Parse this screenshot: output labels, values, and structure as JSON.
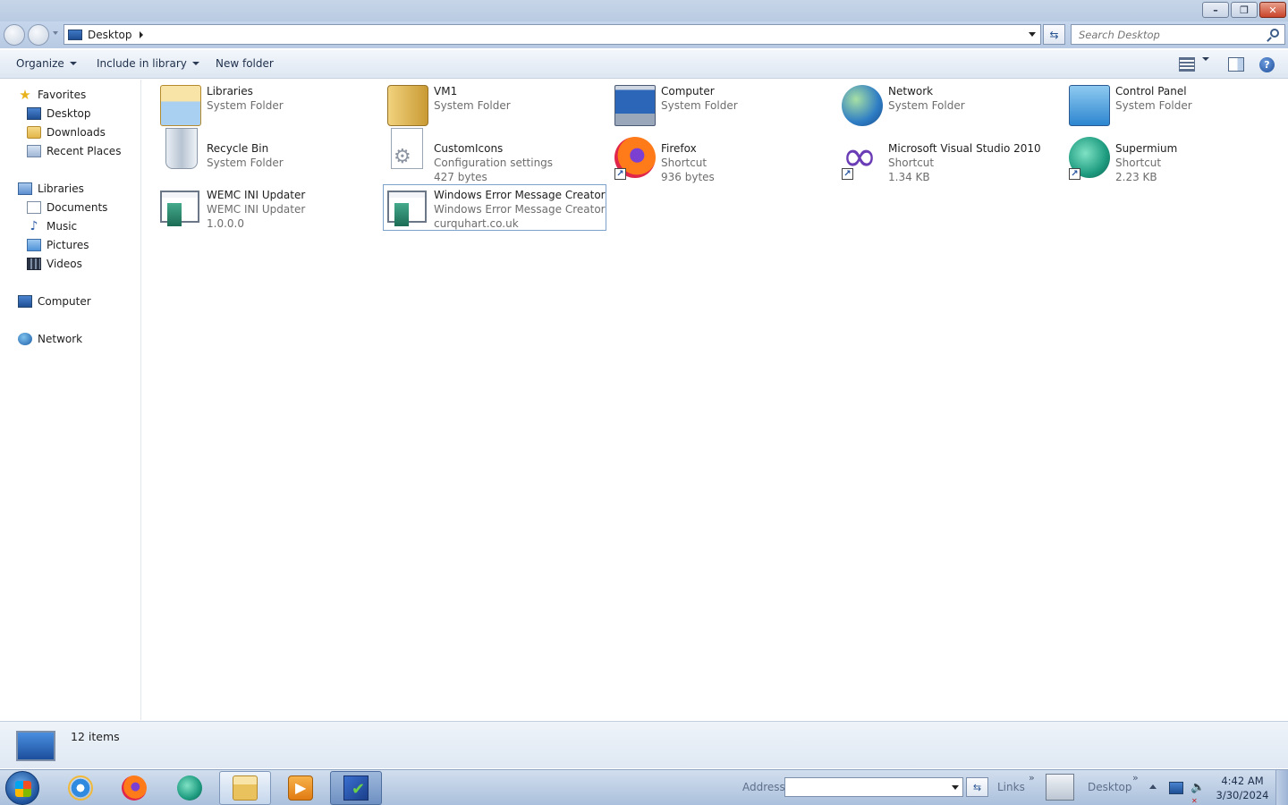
{
  "window": {
    "address_crumb": "Desktop",
    "search_placeholder": "Search Desktop"
  },
  "toolbar": {
    "organize": "Organize",
    "include_in_library": "Include in library",
    "new_folder": "New folder"
  },
  "sidebar": {
    "favorites": {
      "header": "Favorites",
      "items": [
        "Desktop",
        "Downloads",
        "Recent Places"
      ]
    },
    "libraries": {
      "header": "Libraries",
      "items": [
        "Documents",
        "Music",
        "Pictures",
        "Videos"
      ]
    },
    "computer": "Computer",
    "network": "Network"
  },
  "items": [
    {
      "name": "Libraries",
      "line2": "System Folder",
      "line3": "",
      "icon": "libraries-folder-icon"
    },
    {
      "name": "VM1",
      "line2": "System Folder",
      "line3": "",
      "icon": "user-folder-icon"
    },
    {
      "name": "Computer",
      "line2": "System Folder",
      "line3": "",
      "icon": "computer-icon"
    },
    {
      "name": "Network",
      "line2": "System Folder",
      "line3": "",
      "icon": "network-globe-icon"
    },
    {
      "name": "Control Panel",
      "line2": "System Folder",
      "line3": "",
      "icon": "control-panel-icon"
    },
    {
      "name": "Recycle Bin",
      "line2": "System Folder",
      "line3": "",
      "icon": "recycle-bin-icon"
    },
    {
      "name": "CustomIcons",
      "line2": "Configuration settings",
      "line3": "427 bytes",
      "icon": "config-file-icon"
    },
    {
      "name": "Firefox",
      "line2": "Shortcut",
      "line3": "936 bytes",
      "icon": "firefox-icon"
    },
    {
      "name": "Microsoft Visual Studio 2010",
      "line2": "Shortcut",
      "line3": "1.34 KB",
      "icon": "visual-studio-icon"
    },
    {
      "name": "Supermium",
      "line2": "Shortcut",
      "line3": "2.23 KB",
      "icon": "supermium-icon"
    },
    {
      "name": "WEMC INI Updater",
      "line2": "WEMC INI Updater",
      "line3": "1.0.0.0",
      "icon": "app-window-icon"
    },
    {
      "name": "Windows Error Message Creator",
      "line2": "Windows Error Message Creator",
      "line3": "curquhart.co.uk",
      "icon": "app-window-icon"
    }
  ],
  "details": {
    "item_count": "12 items"
  },
  "taskbar": {
    "address_label": "Address",
    "links_label": "Links",
    "desktop_label": "Desktop",
    "time": "4:42 AM",
    "date": "3/30/2024"
  }
}
